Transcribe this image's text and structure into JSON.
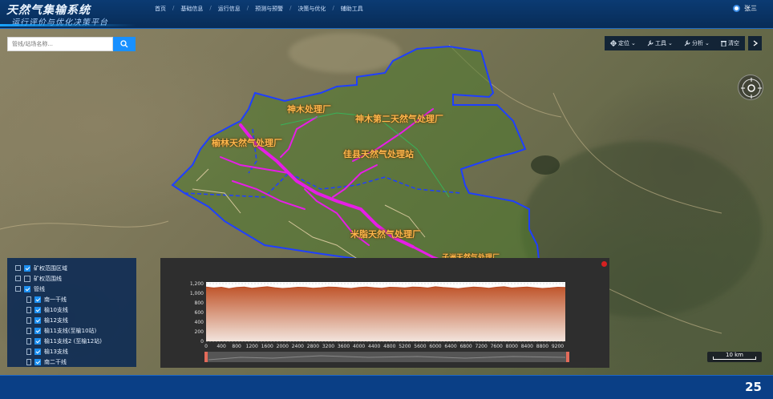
{
  "header": {
    "title": "天然气集输系统",
    "subtitle": "运行评价与优化决策平台",
    "nav": [
      "首页",
      "基础信息",
      "运行信息",
      "预测与预警",
      "决策与优化",
      "辅助工具"
    ],
    "nav_separator": "/",
    "user_name": "张三"
  },
  "search": {
    "placeholder": "管线/站场名称..."
  },
  "toolbar": {
    "locate": "定位",
    "tools": "工具",
    "analysis": "分析",
    "clear": "清空"
  },
  "map": {
    "labels": [
      "神木处理厂",
      "神木第二天然气处理厂",
      "榆林天然气处理厂",
      "佳县天然气处理站",
      "米脂天然气处理厂",
      "子洲天然气处理厂"
    ],
    "colors": {
      "boundary": "#1f3fff",
      "pipeline": "#e61ee6",
      "plant_label": "#ffb84d"
    }
  },
  "layers": {
    "items": [
      {
        "label": "矿权范围区域",
        "checked": true
      },
      {
        "label": "矿权范围线",
        "checked": false
      },
      {
        "label": "管线",
        "checked": true
      },
      {
        "label": "南一干线",
        "checked": true
      },
      {
        "label": "榆10支线",
        "checked": true
      },
      {
        "label": "榆12支线",
        "checked": true
      },
      {
        "label": "榆11支线(至榆10站)",
        "checked": true
      },
      {
        "label": "榆11支线2 (至榆12站)",
        "checked": true
      },
      {
        "label": "榆13支线",
        "checked": true
      },
      {
        "label": "南二干线",
        "checked": true
      }
    ]
  },
  "chart_data": {
    "type": "area",
    "x": [
      0,
      200,
      400,
      600,
      800,
      1000,
      1200,
      1400,
      1600,
      1800,
      2000,
      2200,
      2400,
      2600,
      2800,
      3000,
      3200,
      3400,
      3600,
      3800,
      4000,
      4200,
      4400,
      4600,
      4800,
      5000,
      5200,
      5400,
      5600,
      5800,
      6000,
      6200,
      6400,
      6600,
      6800,
      7000,
      7200,
      7400,
      7600,
      7800,
      8000,
      8200,
      8400,
      8600,
      8800,
      9000,
      9200,
      9400
    ],
    "y": [
      1130,
      1110,
      1125,
      1095,
      1120,
      1130,
      1105,
      1120,
      1135,
      1115,
      1100,
      1110,
      1125,
      1120,
      1105,
      1115,
      1130,
      1125,
      1110,
      1100,
      1120,
      1130,
      1115,
      1105,
      1125,
      1120,
      1110,
      1130,
      1125,
      1110,
      1135,
      1120,
      1110,
      1095,
      1115,
      1130,
      1120,
      1105,
      1125,
      1135,
      1110,
      1120,
      1130,
      1115,
      1100,
      1110,
      1125,
      1120
    ],
    "xticks": [
      0,
      400,
      800,
      1200,
      1600,
      2000,
      2400,
      2800,
      3200,
      3600,
      4000,
      4400,
      4800,
      5200,
      5600,
      6000,
      6400,
      6800,
      7200,
      7600,
      8000,
      8400,
      8800,
      9200
    ],
    "yticks": [
      0,
      200,
      400,
      600,
      800,
      1000,
      1200
    ],
    "xlim": [
      0,
      9400
    ],
    "ylim": [
      0,
      1200
    ],
    "grid": true,
    "colors": {
      "fill_top": "#c0552b",
      "fill_bottom": "#f2e4dc",
      "line": "#b84a24",
      "background": "#ffffff"
    }
  },
  "scale_bar": {
    "label": "10 km"
  },
  "footer": {
    "page_number": "25"
  }
}
